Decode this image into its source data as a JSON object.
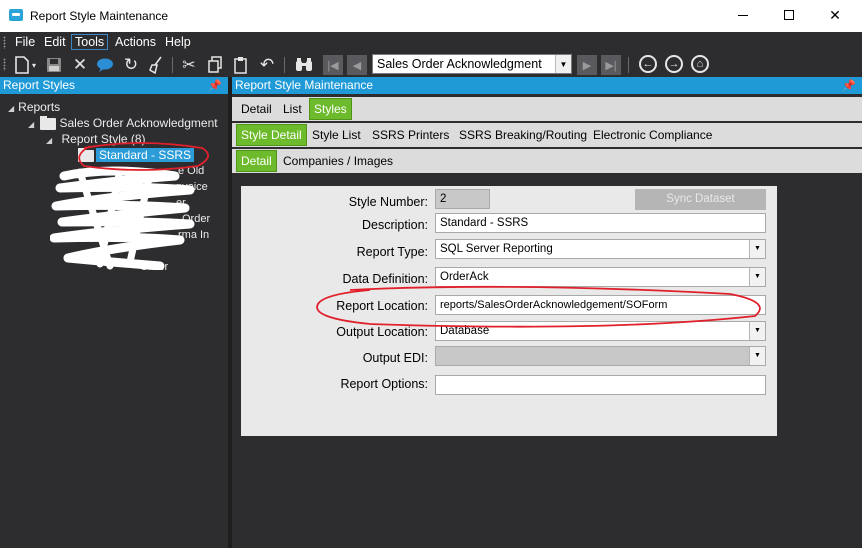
{
  "window": {
    "title": "Report Style Maintenance",
    "minimize_glyph": "—",
    "maximize_glyph": "☐",
    "close_glyph": "✕"
  },
  "menu": {
    "items": [
      "File",
      "Edit",
      "Tools",
      "Actions",
      "Help"
    ],
    "highlighted": "Tools"
  },
  "toolbar": {
    "record_selector": "Sales Order Acknowledgment",
    "icons": [
      "new-icon",
      "save-icon",
      "delete-icon",
      "comment-icon",
      "refresh-icon",
      "clear-icon",
      "cut-icon",
      "copy-icon",
      "paste-icon",
      "undo-icon",
      "binoculars-icon",
      "first-icon",
      "prev-icon",
      "next-icon",
      "last-icon",
      "back-icon",
      "forward-icon",
      "home-icon"
    ]
  },
  "left_panel": {
    "header": "Report Styles",
    "tree": {
      "root": "Reports",
      "level1": "Sales Order Acknowledgment",
      "level2": "Report Style (8)",
      "selected": "Standard - SSRS",
      "obscured_fragments": [
        "e Old",
        "nvoice",
        "er",
        "Order",
        "rma In",
        "Order"
      ]
    }
  },
  "right_panel": {
    "header": "Report Style Maintenance",
    "tabs_row1": [
      "Detail",
      "List",
      "Styles"
    ],
    "tabs_row1_active": "Styles",
    "tabs_row2": [
      "Style Detail",
      "Style List",
      "SSRS Printers",
      "SSRS Breaking/Routing",
      "Electronic Compliance"
    ],
    "tabs_row2_active": "Style Detail",
    "tabs_row3": [
      "Detail",
      "Companies / Images"
    ],
    "tabs_row3_active": "Detail",
    "sync_button": "Sync Dataset",
    "fields": {
      "style_number": {
        "label": "Style Number:",
        "value": "2"
      },
      "description": {
        "label": "Description:",
        "value": "Standard - SSRS"
      },
      "report_type": {
        "label": "Report Type:",
        "value": "SQL Server Reporting"
      },
      "data_definition": {
        "label": "Data Definition:",
        "value": "OrderAck"
      },
      "report_location": {
        "label": "Report Location:",
        "value": "reports/SalesOrderAcknowledgement/SOForm"
      },
      "output_location": {
        "label": "Output Location:",
        "value": "Database"
      },
      "output_edi": {
        "label": "Output EDI:",
        "value": ""
      },
      "report_options": {
        "label": "Report Options:",
        "value": ""
      }
    }
  },
  "colors": {
    "dark_bg": "#2d2d30",
    "header_blue": "#1f9ad6",
    "tab_green": "#6dbb2c",
    "annotation_red": "#e0202a"
  }
}
